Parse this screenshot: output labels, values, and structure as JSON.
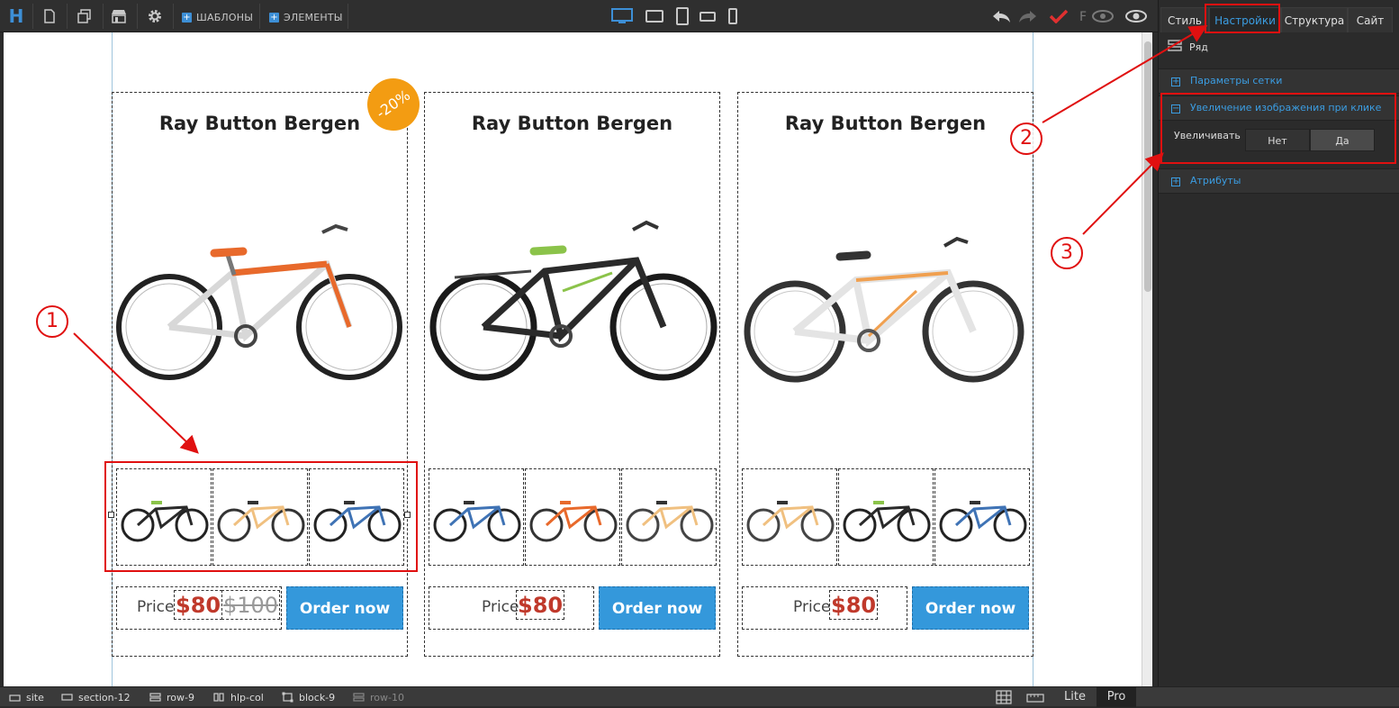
{
  "toolbar": {
    "logo": "H",
    "templates_label": "ШАБЛОНЫ",
    "elements_label": "ЭЛЕМЕНТЫ"
  },
  "panel": {
    "tabs": [
      "Стиль",
      "Настройки",
      "Структура",
      "Сайт"
    ],
    "active_tab": "Настройки",
    "element_type": "Ряд",
    "sections": {
      "grid": "Параметры сетки",
      "zoom": "Увеличение изображения при клике",
      "attributes": "Атрибуты"
    },
    "zoom_option_label": "Увеличивать",
    "zoom_options": [
      "Нет",
      "Да"
    ],
    "zoom_selected": "Да"
  },
  "products": [
    {
      "title": "Ray Button Bergen",
      "price_label": "Price",
      "price": "$80",
      "old_price": "$100",
      "badge": "-20%",
      "button": "Order now"
    },
    {
      "title": "Ray Button Bergen",
      "price_label": "Price",
      "price": "$80",
      "button": "Order now"
    },
    {
      "title": "Ray Button Bergen",
      "price_label": "Price",
      "price": "$80",
      "button": "Order now"
    }
  ],
  "annotations": [
    "1",
    "2",
    "3"
  ],
  "breadcrumbs": [
    "site",
    "section-12",
    "row-9",
    "hlp-col",
    "block-9",
    "row-10"
  ],
  "modes": [
    "Lite",
    "Pro"
  ],
  "active_mode": "Pro",
  "colors": {
    "accent": "#3b9de2",
    "button": "#3498db",
    "price": "#c0392b",
    "badge": "#f39c12",
    "annotation": "#e01010",
    "bike_main_1": "#e8692b",
    "bike_main_2": "#8bc34a",
    "bike_main_3": "#f0a050"
  }
}
